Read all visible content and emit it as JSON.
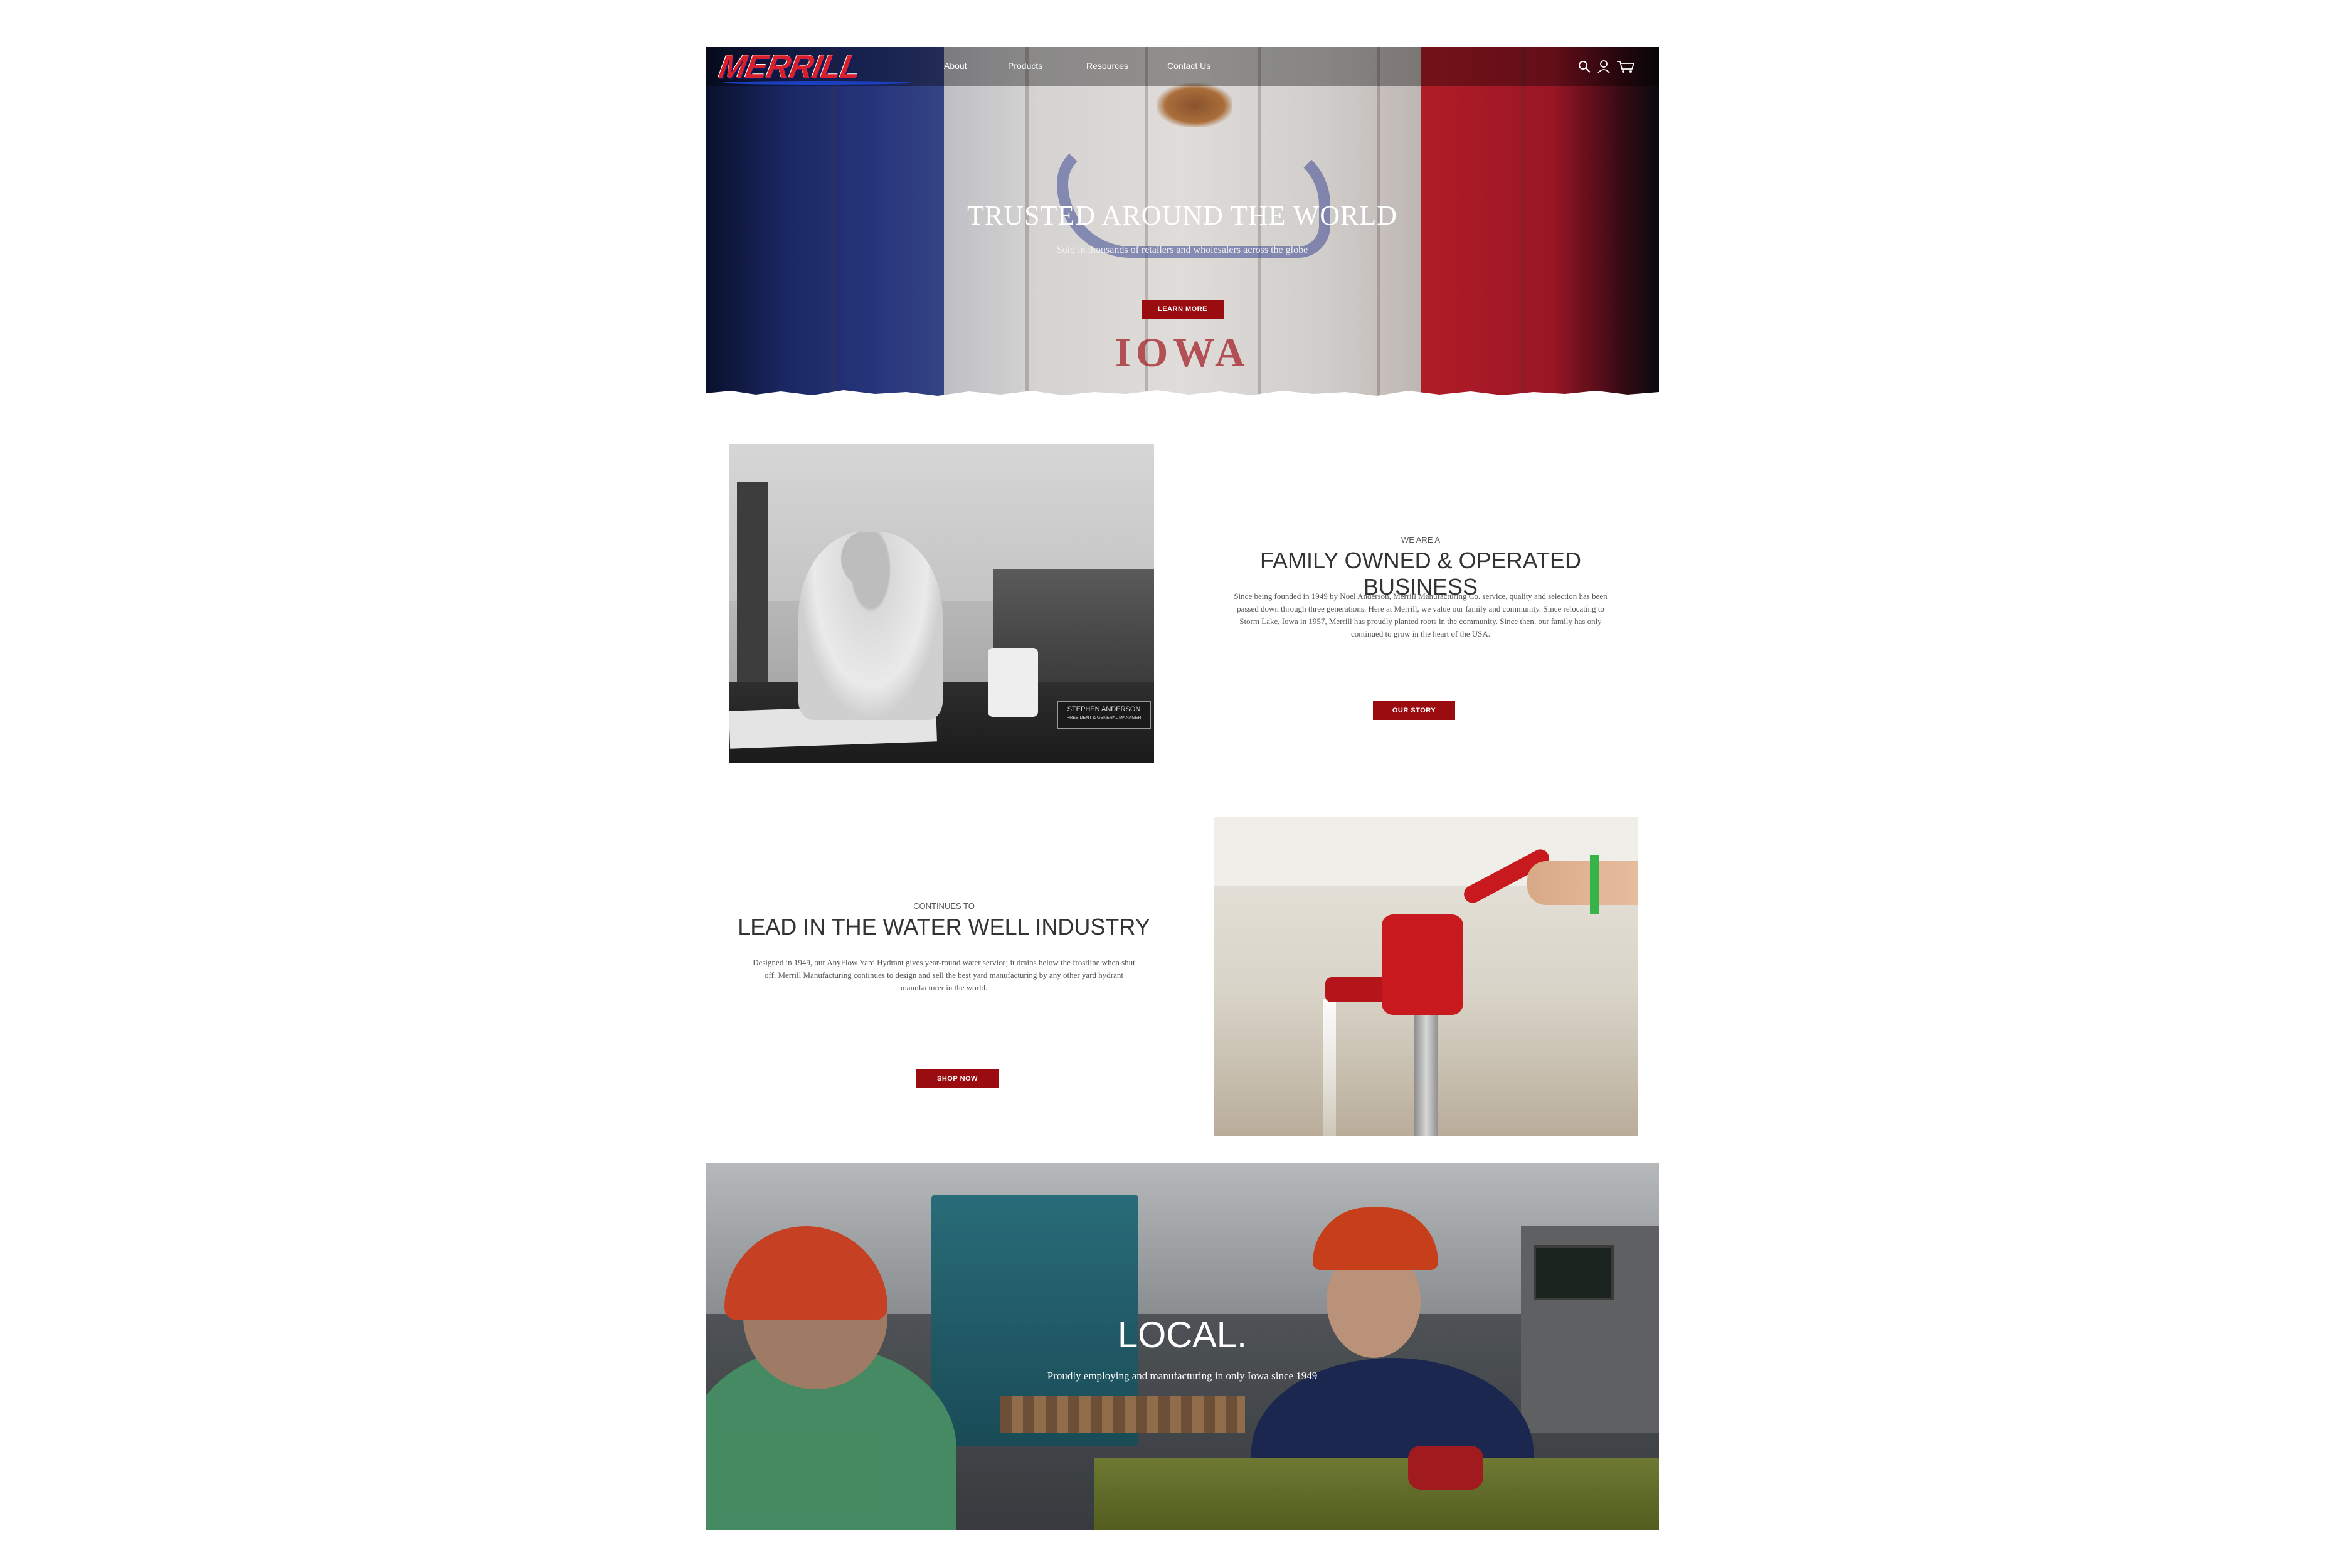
{
  "nav": {
    "logo_text": "MERRILL",
    "items": [
      "About",
      "Products",
      "Resources",
      "Contact Us"
    ],
    "icons": [
      "search-icon",
      "account-icon",
      "cart-icon"
    ]
  },
  "hero": {
    "title": "TRUSTED AROUND THE WORLD",
    "subtitle": "Sold in thousands of retailers and wholesalers across the globe",
    "button": "LEARN MORE",
    "flag_text": "IOWA"
  },
  "family": {
    "nameplate_line1": "STEPHEN ANDERSON",
    "nameplate_line2": "PRESIDENT & GENERAL MANAGER",
    "kicker": "WE ARE A",
    "title": "FAMILY OWNED & OPERATED BUSINESS",
    "body": "Since being founded in 1949 by Noel Anderson, Merrill Manufacturing Co. service, quality and selection has been passed down through three generations. Here at Merrill, we value our family and community. Since relocating to Storm Lake, Iowa in 1957, Merrill has proudly planted roots in the community. Since then, our family has only continued to grow in the heart of the USA.",
    "button": "OUR STORY"
  },
  "water": {
    "kicker": "CONTINUES TO",
    "title": "LEAD IN THE WATER WELL INDUSTRY",
    "body": "Designed in 1949, our AnyFlow Yard Hydrant gives year-round water service; it drains below the frostline when shut off. Merrill Manufacturing continues to design and sell the best yard manufacturing by any other yard hydrant manufacturer in the world.",
    "button": "SHOP NOW"
  },
  "local": {
    "title": "LOCAL.",
    "subtitle": "Proudly employing and manufacturing in only Iowa since 1949"
  },
  "colors": {
    "button_red": "#9b0c10",
    "flag_blue": "#1e2c6e",
    "flag_red": "#c0202a"
  }
}
